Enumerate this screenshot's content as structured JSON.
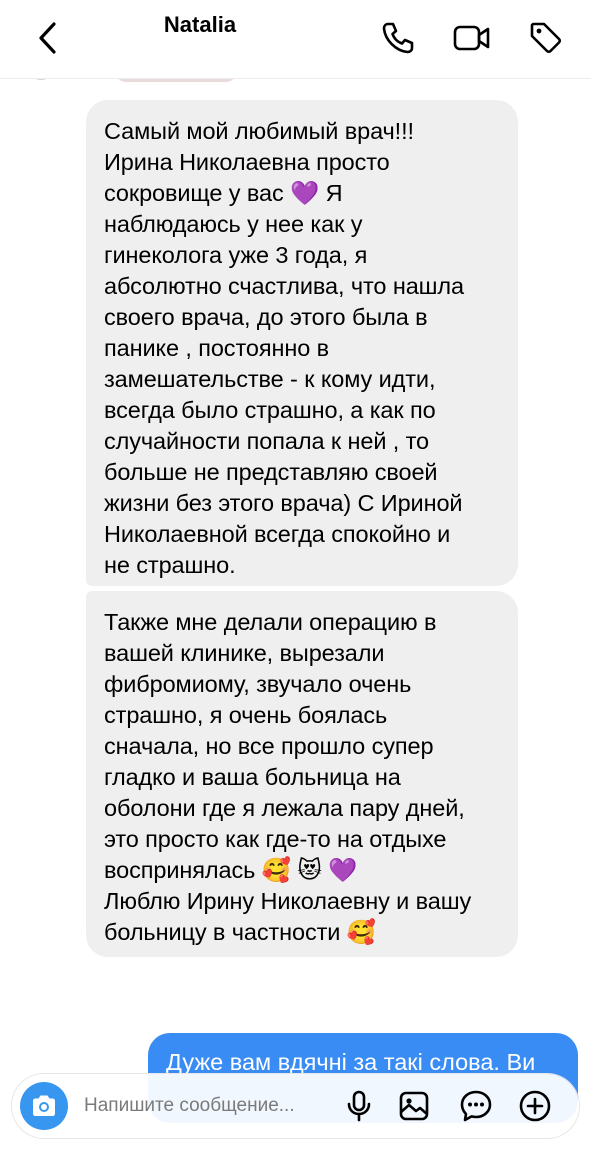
{
  "header": {
    "title": "Natalia",
    "icons": {
      "back": "chevron-left-icon",
      "call": "phone-icon",
      "video": "video-camera-icon",
      "tag": "tag-icon"
    }
  },
  "messages": [
    {
      "sender": "incoming",
      "text": "Самый мой любимый врач!!!\nИрина Николаевна просто\nсокровище у вас 💜 Я\nнаблюдаюсь у нее как у\nгинеколога уже 3 года, я\nабсолютно счастлива, что нашла\nсвоего врача, до этого была в\nпанике , постоянно в\nзамешательстве - к кому идти,\nвсегда было страшно, а как по\nслучайности попала к ней , то\nбольше не представляю своей\nжизни без этого врача) С Ириной\nНиколаевной всегда спокойно и\nне страшно."
    },
    {
      "sender": "incoming",
      "text": "Также мне делали операцию в\nвашей клинике, вырезали\nфибромиому, звучало очень\nстрашно, я очень боялась\nсначала, но все прошло супер\nгладко и ваша больница на\nоболони где я лежала пару дней,\nэто просто как где-то на отдыхе\nвоспринялась 🥰 😻 💜\nЛюблю Ирину Николаевну и вашу\nбольницу в частности 🥰"
    },
    {
      "sender": "outgoing",
      "text": "Дуже вам вдячні за такі слова. Ви"
    }
  ],
  "composer": {
    "placeholder": "Напишите сообщение...",
    "value": "",
    "icons": {
      "camera": "camera-icon",
      "mic": "microphone-icon",
      "gallery": "image-icon",
      "sticker": "sticker-chat-icon",
      "plus": "plus-circle-icon"
    }
  },
  "colors": {
    "incoming_bubble": "#efefef",
    "outgoing_bubble": "#3a8cf5",
    "camera_button": "#3797f0"
  }
}
